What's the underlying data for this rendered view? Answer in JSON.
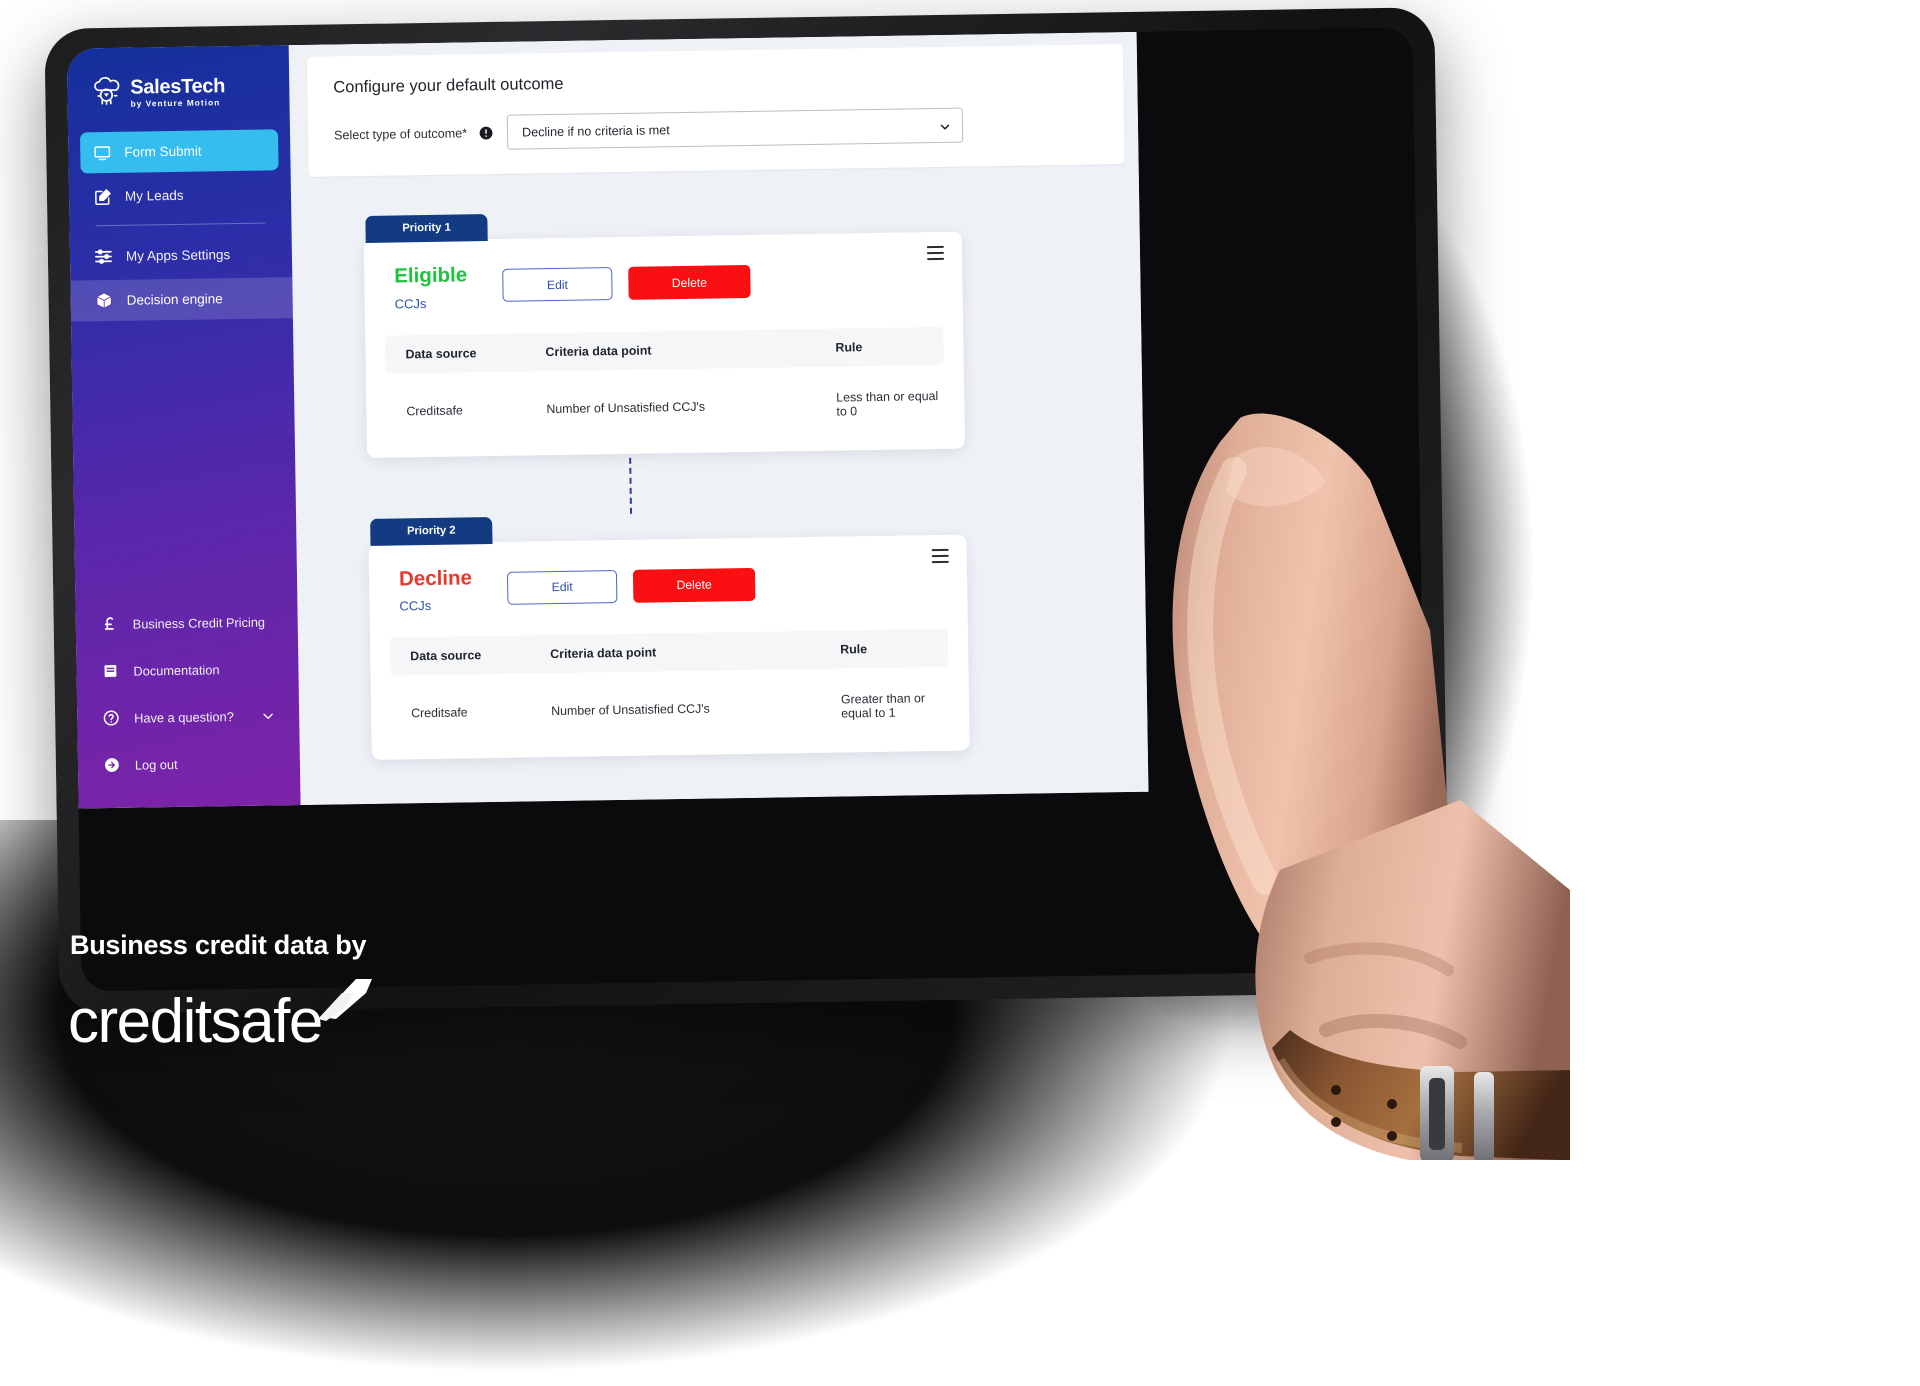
{
  "app": {
    "brand_name": "SalesTech",
    "brand_tagline": "by Venture Motion",
    "brand_logo_icon": "sheep-cloud-icon"
  },
  "sidebar": {
    "top_items": [
      {
        "label": "Form Submit",
        "icon": "monitor-icon",
        "state": "active-cyan"
      },
      {
        "label": "My Leads",
        "icon": "edit-square-icon",
        "state": "default"
      },
      {
        "label": "My Apps Settings",
        "icon": "sliders-icon",
        "state": "default"
      },
      {
        "label": "Decision engine",
        "icon": "cube-icon",
        "state": "active-soft"
      }
    ],
    "bottom_items": [
      {
        "label": "Business Credit Pricing",
        "icon": "pound-sterling-icon",
        "has_chevron": false
      },
      {
        "label": "Documentation",
        "icon": "book-icon",
        "has_chevron": false
      },
      {
        "label": "Have a question?",
        "icon": "question-circle-icon",
        "has_chevron": true
      },
      {
        "label": "Log out",
        "icon": "logout-arrow-icon",
        "has_chevron": false
      }
    ]
  },
  "panel": {
    "title": "Configure your default outcome",
    "field_label": "Select type of outcome*",
    "info_icon": "info-icon",
    "select_value": "Decline if no criteria is met",
    "select_chevron_icon": "chevron-down-icon"
  },
  "flow": {
    "table_headers": [
      "Data source",
      "Criteria data point",
      "Rule"
    ],
    "edit_label": "Edit",
    "delete_label": "Delete",
    "kebab_icon": "hamburger-menu-icon",
    "groups": [
      {
        "priority_label": "Priority 1",
        "outcome": "Eligible",
        "outcome_kind": "eligible",
        "subtitle": "CCJs",
        "rows": [
          {
            "data_source": "Creditsafe",
            "criteria": "Number of Unsatisfied CCJ's",
            "rule": "Less than or equal to 0"
          }
        ]
      },
      {
        "priority_label": "Priority 2",
        "outcome": "Decline",
        "outcome_kind": "decline",
        "subtitle": "CCJs",
        "rows": [
          {
            "data_source": "Creditsafe",
            "criteria": "Number of Unsatisfied CCJ's",
            "rule": "Greater than or equal to 1"
          }
        ]
      }
    ]
  },
  "branding": {
    "tagline": "Business credit data by",
    "logo_word": "creditsafe",
    "logo_mark_icon": "creditsafe-swoosh-icon"
  },
  "colors": {
    "accent_cyan": "#35BDEF",
    "sidebar_start": "#14309B",
    "sidebar_end": "#7D23A8",
    "priority_tab": "#123B82",
    "eligible_green": "#1FC23F",
    "decline_red": "#E8392C",
    "delete_red": "#FA0F12",
    "edit_blue": "#2F4BB5",
    "canvas_grey": "#EEF1F6"
  }
}
